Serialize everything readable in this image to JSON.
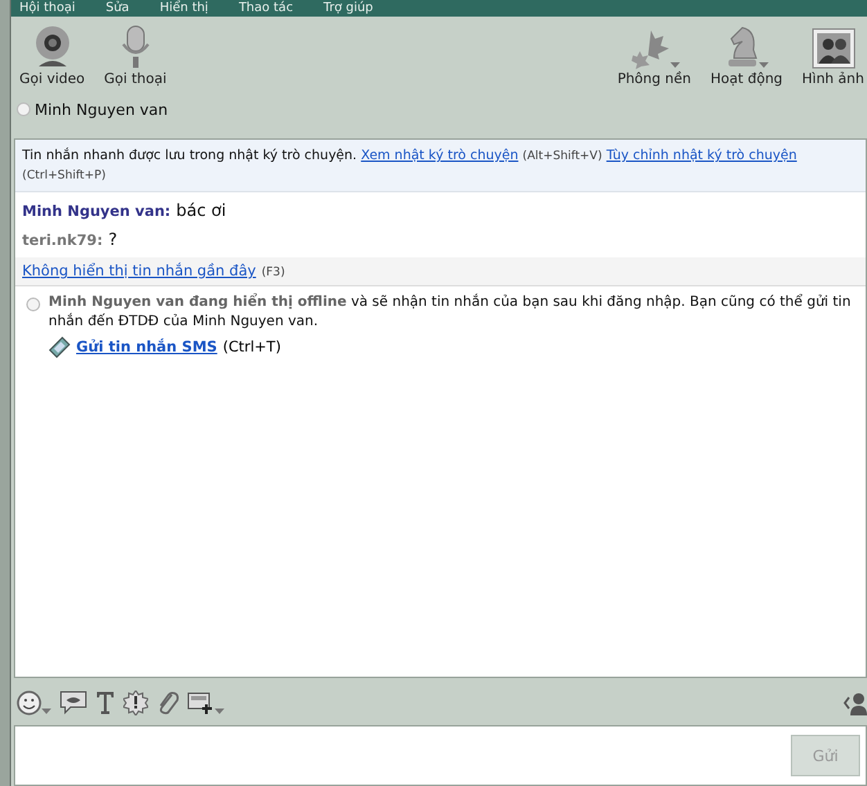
{
  "menu": [
    "Hội thoại",
    "Sửa",
    "Hiển thị",
    "Thao tác",
    "Trợ giúp"
  ],
  "left_tools": [
    {
      "kind": "video",
      "label": "Gọi video"
    },
    {
      "kind": "voice",
      "label": "Gọi thoại"
    }
  ],
  "right_tools": [
    {
      "kind": "leaf",
      "label": "Phông nền",
      "dropdown": true
    },
    {
      "kind": "chess",
      "label": "Hoạt động",
      "dropdown": true
    },
    {
      "kind": "photo",
      "label": "Hình ảnh",
      "dropdown": false
    }
  ],
  "contact": {
    "name": "Minh Nguyen van",
    "online": false
  },
  "notice": {
    "text": "Tin nhắn nhanh được lưu trong nhật ký trò chuyện.",
    "link1": "Xem nhật ký trò chuyện",
    "key1": "(Alt+Shift+V)",
    "link2": "Tùy chỉnh nhật ký trò chuyện",
    "key2": "(Ctrl+Shift+P)"
  },
  "messages": [
    {
      "sender": "Minh Nguyen van:",
      "text": "bác ơi",
      "self": false
    },
    {
      "sender": "teri.nk79:",
      "text": "?",
      "self": true
    }
  ],
  "hide_recent": {
    "link": "Không hiển thị tin nhắn gần đây",
    "key": "(F3)"
  },
  "offline_notice": {
    "text": "**Minh Nguyen van đang hiển thị offline** và sẽ nhận tin nhắn của bạn sau khi đăng nhập. Bạn cũng có thể gửi tin nhắn đến ĐTDĐ của Minh Nguyen van.",
    "link": "Gửi tin nhắn SMS",
    "key": "(Ctrl+T)"
  },
  "compose_tools": [
    {
      "kind": "smiley",
      "dropdown": true
    },
    {
      "kind": "lips",
      "dropdown": false
    },
    {
      "kind": "text",
      "dropdown": false
    },
    {
      "kind": "buzz",
      "dropdown": false
    },
    {
      "kind": "clip",
      "dropdown": false
    },
    {
      "kind": "screen",
      "dropdown": true
    }
  ],
  "send_button": {
    "label": "Gửi",
    "disabled": true
  }
}
